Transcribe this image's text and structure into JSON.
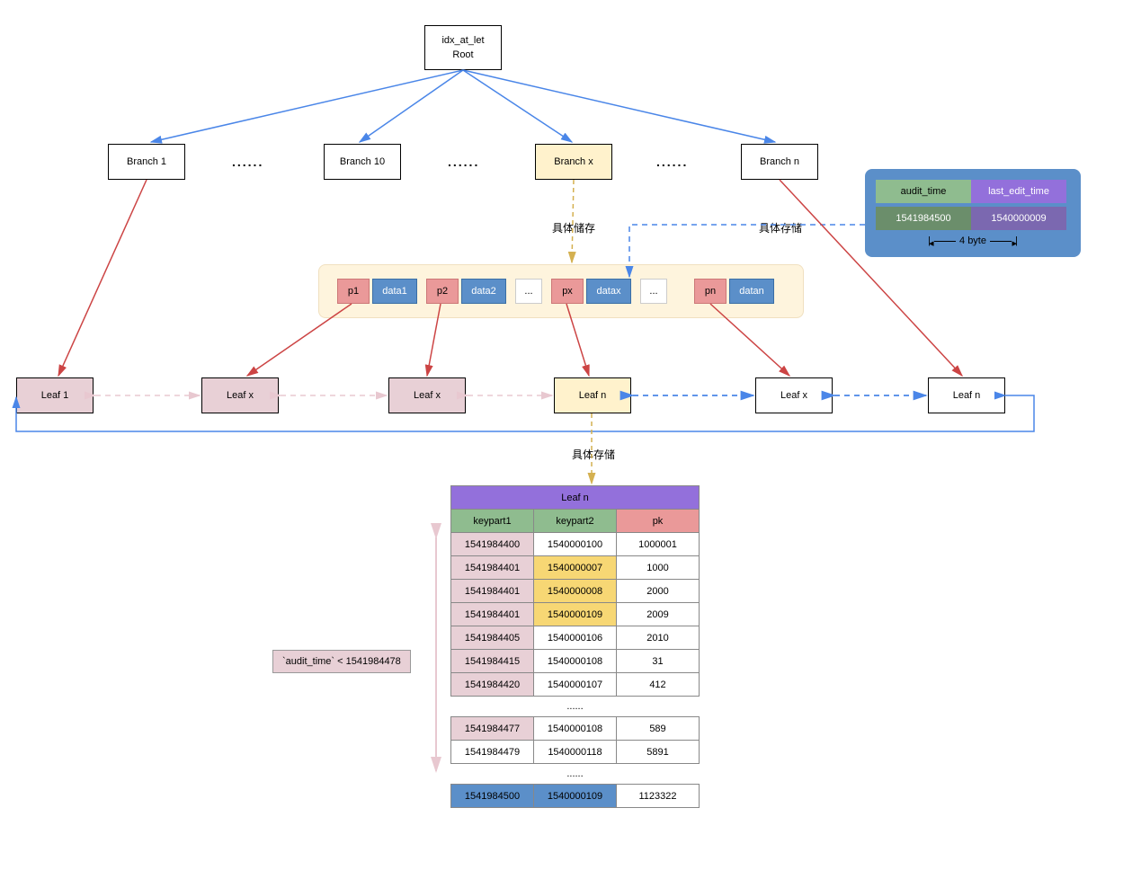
{
  "root": {
    "line1": "idx_at_let",
    "line2": "Root"
  },
  "branches": {
    "b1": "Branch 1",
    "b10": "Branch 10",
    "bx": "Branch x",
    "bn": "Branch n"
  },
  "ellipsis": "......",
  "storage_labels": {
    "l1": "具体储存",
    "l2": "具体存储",
    "l3": "具体存储"
  },
  "inner_cells": [
    "p1",
    "data1",
    "p2",
    "data2",
    "...",
    "px",
    "datax",
    "...",
    "pn",
    "datan"
  ],
  "leaves": {
    "l1": "Leaf 1",
    "lx": "Leaf x",
    "ln": "Leaf n"
  },
  "side_panel": {
    "h1": "audit_time",
    "h2": "last_edit_time",
    "v1": "1541984500",
    "v2": "1540000009",
    "byte": "4 byte"
  },
  "annotation": "`audit_time` < 1541984478",
  "table": {
    "title": "Leaf n",
    "headers": [
      "keypart1",
      "keypart2",
      "pk"
    ],
    "rows": [
      {
        "kp1": "1541984400",
        "kp2": "1540000100",
        "pk": "1000001",
        "hl": false
      },
      {
        "kp1": "1541984401",
        "kp2": "1540000007",
        "pk": "1000",
        "hl": true
      },
      {
        "kp1": "1541984401",
        "kp2": "1540000008",
        "pk": "2000",
        "hl": true
      },
      {
        "kp1": "1541984401",
        "kp2": "1540000109",
        "pk": "2009",
        "hl": true
      },
      {
        "kp1": "1541984405",
        "kp2": "1540000106",
        "pk": "2010",
        "hl": false
      },
      {
        "kp1": "1541984415",
        "kp2": "1540000108",
        "pk": "31",
        "hl": false
      },
      {
        "kp1": "1541984420",
        "kp2": "1540000107",
        "pk": "412",
        "hl": false
      }
    ],
    "rows2": [
      {
        "kp1": "1541984477",
        "kp2": "1540000108",
        "pk": "589",
        "pink": true
      },
      {
        "kp1": "1541984479",
        "kp2": "1540000118",
        "pk": "5891",
        "pink": false
      }
    ],
    "row_blue": {
      "kp1": "1541984500",
      "kp2": "1540000109",
      "pk": "1123322"
    }
  }
}
